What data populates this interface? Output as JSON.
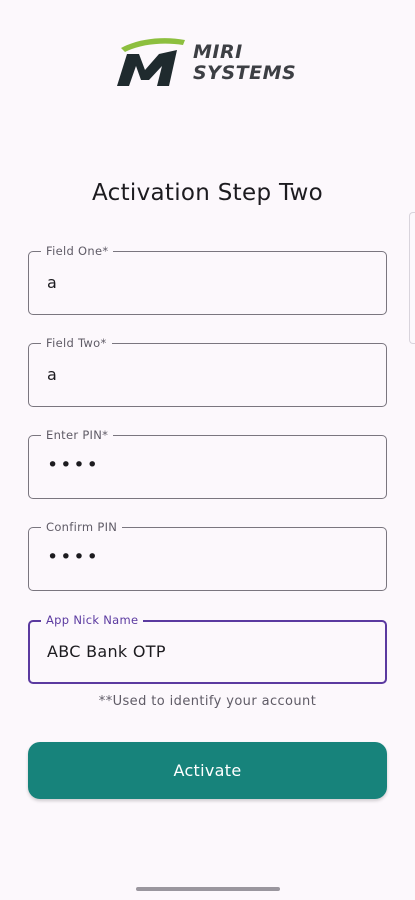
{
  "logo": {
    "line1": "MIRI",
    "line2": "SYSTEMS",
    "icon": "miri-systems-logo"
  },
  "page": {
    "title": "Activation Step Two"
  },
  "fields": [
    {
      "label": "Field One*",
      "value": "a"
    },
    {
      "label": "Field Two*",
      "value": "a"
    },
    {
      "label": "Enter PIN*",
      "value": "••••"
    },
    {
      "label": "Confirm PIN",
      "value": "••••"
    },
    {
      "label": "App Nick Name",
      "value": "ABC Bank OTP"
    }
  ],
  "helper_text": "**Used to identify your account",
  "activate_button": "Activate",
  "colors": {
    "primary": "#17837b",
    "focus": "#5b3aa0",
    "background": "#fcf8fc",
    "logo_green": "#8dbf3f",
    "logo_dark": "#1f2a2e"
  }
}
